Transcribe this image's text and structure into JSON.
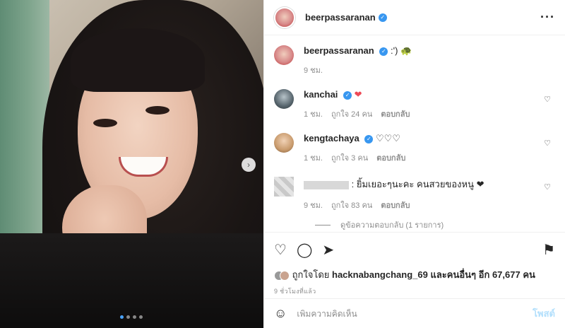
{
  "post": {
    "owner": "beerpassaranan",
    "menu_icon": "more-icon",
    "carousel_dots": 4,
    "carousel_active": 0
  },
  "caption": {
    "user": "beerpassaranan",
    "text": ":') 🐢",
    "time": "9 ชม."
  },
  "comments": [
    {
      "user": "kanchai",
      "text": "❤",
      "time": "1 ชม.",
      "likes": "ถูกใจ 24 คน",
      "reply": "ตอบกลับ"
    },
    {
      "user": "kengtachaya",
      "text": "♡♡♡",
      "time": "1 ชม.",
      "likes": "ถูกใจ 3 คน",
      "reply": "ตอบกลับ"
    },
    {
      "user": "",
      "text": ": ยิ้มเยอะๆนะคะ คนสวยของหนู ❤",
      "time": "9 ชม.",
      "likes": "ถูกใจ 83 คน",
      "reply": "ตอบกลับ"
    }
  ],
  "view_replies": "ดูข้อความตอบกลับ (1 รายการ)",
  "likes_line": {
    "prefix": "ถูกใจโดย",
    "user": "hacknabangchang_69",
    "suffix": "และคนอื่นๆ อีก 67,677 คน"
  },
  "timestamp": "9 ชั่วโมงที่แล้ว",
  "comment_box": {
    "placeholder": "เพิ่มความคิดเห็น",
    "post_label": "โพสต์"
  },
  "colors": {
    "verified": "#3897f0",
    "like_red": "#ed4956",
    "post_disabled": "#b2dffc"
  }
}
